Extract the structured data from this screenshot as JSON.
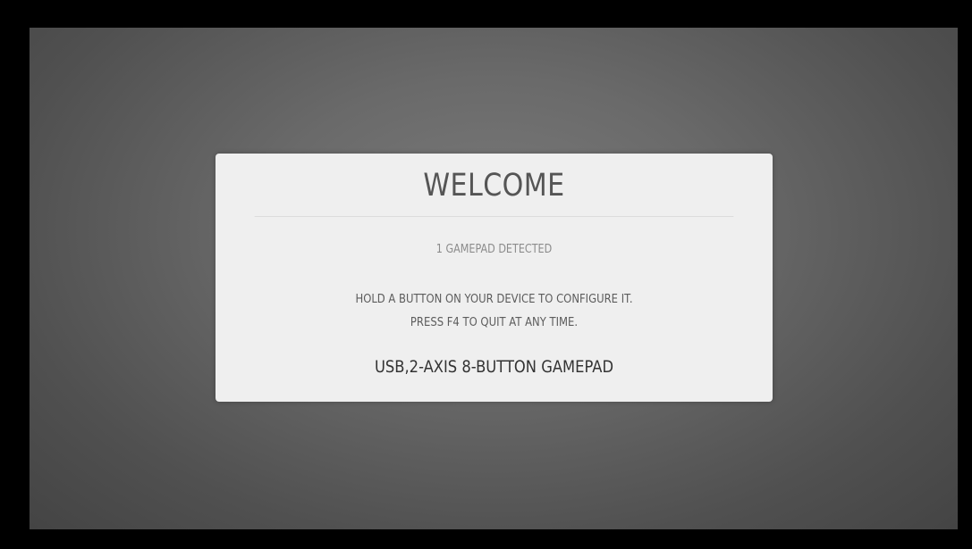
{
  "dialog": {
    "title": "WELCOME",
    "detected_text": "1 GAMEPAD DETECTED",
    "instruction_line1": "HOLD A BUTTON ON YOUR DEVICE TO CONFIGURE IT.",
    "instruction_line2": "PRESS F4 TO QUIT AT ANY TIME.",
    "device_name": "USB,2-AXIS 8-BUTTON GAMEPAD"
  },
  "colors": {
    "dialog_background": "#efefef",
    "title_text": "#555555",
    "detected_text": "#8c8c8c",
    "instruction_text": "#5c5c5c",
    "device_text": "#333333"
  }
}
